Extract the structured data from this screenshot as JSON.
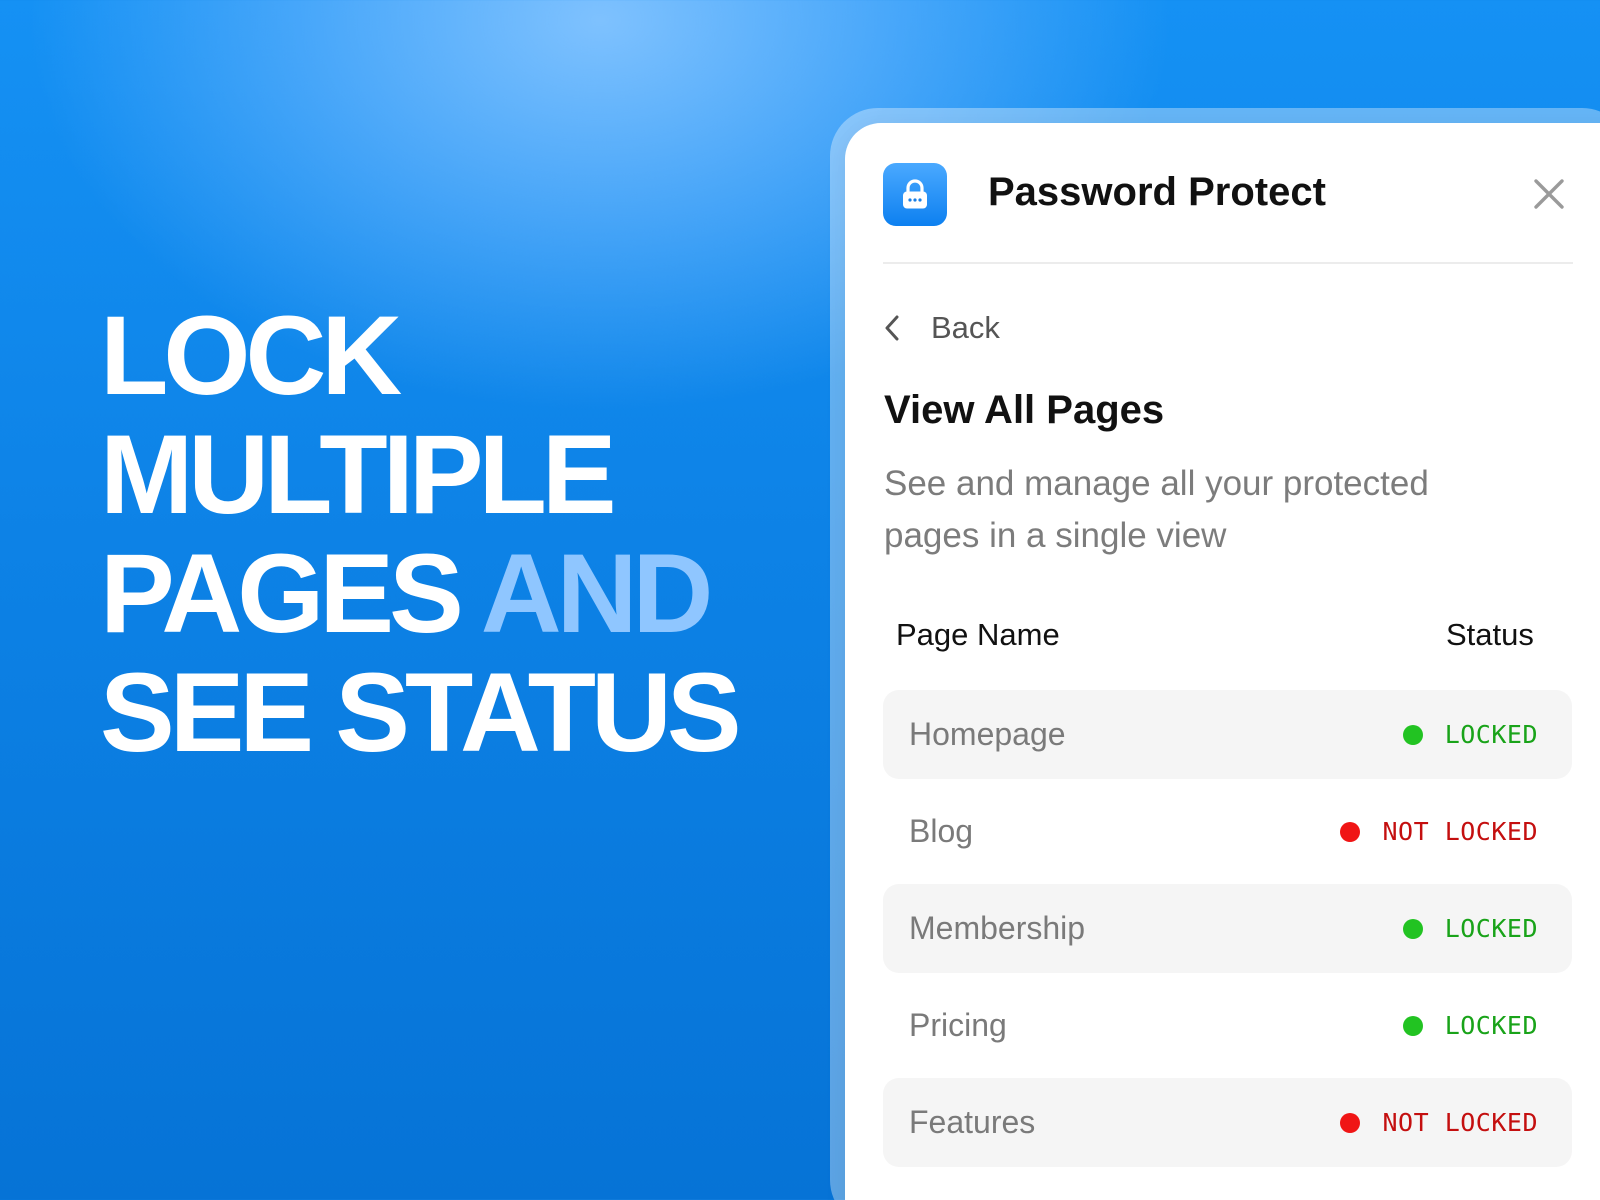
{
  "headline": {
    "line1": "LOCK",
    "line2": "MULTIPLE",
    "line3_main": "PAGES",
    "line3_accent": "AND",
    "line4": "SEE STATUS"
  },
  "panel": {
    "app_title": "Password Protect",
    "app_icon": "lock-icon",
    "close_icon": "close-icon",
    "back_label": "Back",
    "section_title": "View All Pages",
    "section_description": "See and manage all your protected pages in a single view",
    "table": {
      "headers": {
        "name": "Page Name",
        "status": "Status"
      },
      "rows": [
        {
          "name": "Homepage",
          "status": "LOCKED",
          "state": "locked"
        },
        {
          "name": "Blog",
          "status": "NOT LOCKED",
          "state": "unlocked"
        },
        {
          "name": "Membership",
          "status": "LOCKED",
          "state": "locked"
        },
        {
          "name": "Pricing",
          "status": "LOCKED",
          "state": "locked"
        },
        {
          "name": "Features",
          "status": "NOT LOCKED",
          "state": "unlocked"
        }
      ]
    }
  },
  "colors": {
    "brand_blue": "#0d82e6",
    "accent_light_blue": "#8fc6ff",
    "locked_green": "#22c322",
    "locked_text": "#19a319",
    "unlocked_red": "#f01515",
    "unlocked_text": "#c40f0f"
  }
}
